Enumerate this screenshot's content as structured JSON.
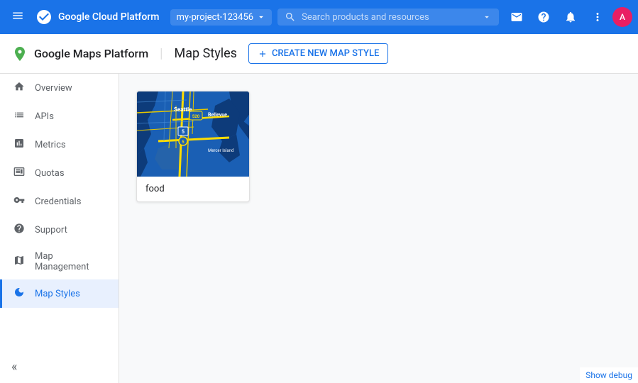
{
  "topBar": {
    "menuLabel": "☰",
    "appName": "Google Cloud Platform",
    "projectName": "my-project-123456",
    "searchPlaceholder": "Search products and resources",
    "icons": {
      "support": "📧",
      "help": "?",
      "notifications": "🔔",
      "more": "⋮"
    },
    "avatarLabel": "A"
  },
  "subHeader": {
    "appName": "Google Maps Platform",
    "pageTitle": "Map Styles",
    "createBtn": {
      "label": "CREATE NEW MAP STYLE",
      "icon": "+"
    }
  },
  "sidebar": {
    "items": [
      {
        "id": "overview",
        "label": "Overview",
        "icon": "home"
      },
      {
        "id": "apis",
        "label": "APIs",
        "icon": "list"
      },
      {
        "id": "metrics",
        "label": "Metrics",
        "icon": "bar_chart"
      },
      {
        "id": "quotas",
        "label": "Quotas",
        "icon": "monitor"
      },
      {
        "id": "credentials",
        "label": "Credentials",
        "icon": "key"
      },
      {
        "id": "support",
        "label": "Support",
        "icon": "person"
      },
      {
        "id": "map-management",
        "label": "Map Management",
        "icon": "layers"
      },
      {
        "id": "map-styles",
        "label": "Map Styles",
        "icon": "palette",
        "active": true
      }
    ],
    "collapseIcon": "«"
  },
  "mapStyles": {
    "cards": [
      {
        "id": "food",
        "label": "food",
        "thumbnailAlt": "Map style thumbnail showing Seattle area"
      }
    ]
  },
  "debugBar": {
    "label": "Show debug"
  }
}
